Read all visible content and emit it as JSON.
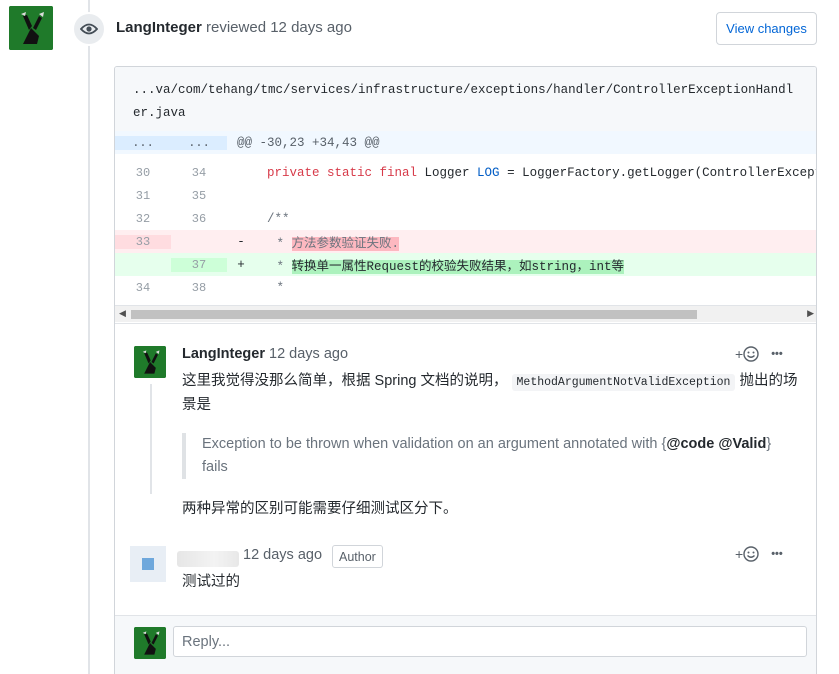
{
  "review": {
    "author": "LangInteger",
    "action": "reviewed 12 days ago",
    "view_changes_label": "View changes"
  },
  "file": {
    "path": "...va/com/tehang/tmc/services/infrastructure/exceptions/handler/ControllerExceptionHandler.java"
  },
  "diff": {
    "hunk_old": "...",
    "hunk_new": "...",
    "hunk_header": "@@ -30,23 +34,43 @@",
    "rows": [
      {
        "old": "30",
        "new": "34",
        "marker": " ",
        "kw1": "private static final",
        "mid": " Logger ",
        "cst": "LOG",
        "rest": " = LoggerFactory.getLogger(ControllerExceptionHandler.class);"
      },
      {
        "old": "31",
        "new": "35",
        "marker": " ",
        "text": ""
      },
      {
        "old": "32",
        "new": "36",
        "marker": " ",
        "text": "/**"
      },
      {
        "old": "33",
        "new": "",
        "marker": "-",
        "prefix": " * ",
        "hl": "方法参数验证失败."
      },
      {
        "old": "",
        "new": "37",
        "marker": "+",
        "prefix": " * ",
        "hl": "转换单一属性Request的校验失败结果，如string，int等"
      },
      {
        "old": "34",
        "new": "38",
        "marker": " ",
        "text": " *"
      }
    ]
  },
  "comment1": {
    "author": "LangInteger",
    "time": "12 days ago",
    "text_before_code": "这里我觉得没那么简单，根据 Spring 文档的说明，",
    "inline_code": "MethodArgumentNotValidException",
    "text_after_code": "抛出的场景是",
    "quote_before": "Exception to be thrown when validation on an argument annotated with {",
    "quote_bold1": "@code",
    "quote_bold2": "@Valid",
    "quote_after": "} fails",
    "closing": "两种异常的区别可能需要仔细测试区分下。",
    "reaction_label": "+",
    "more_label": "•••"
  },
  "comment2": {
    "time": "12 days ago",
    "badge": "Author",
    "text": "测试过的",
    "reaction_label": "+",
    "more_label": "•••"
  },
  "reply": {
    "placeholder": "Reply..."
  },
  "colors": {
    "avatar_green": "#1f7a2a",
    "link_blue": "#0366d6",
    "deletion_bg": "#ffeef0",
    "addition_bg": "#e6ffed"
  }
}
